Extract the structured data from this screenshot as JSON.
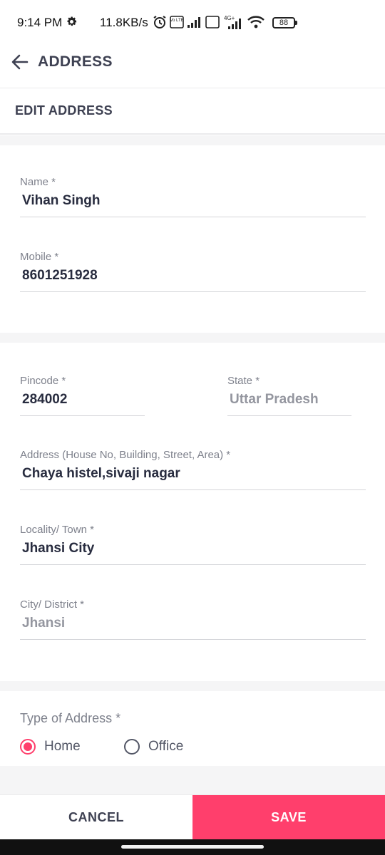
{
  "status_bar": {
    "time": "9:14 PM",
    "net_speed": "11.8KB/s",
    "battery": "88",
    "network_label": "4G+",
    "volte_label": "Vo LTE",
    "icons": [
      "gear-icon",
      "alarm-icon",
      "signal-icon",
      "wifi-icon",
      "battery-icon"
    ]
  },
  "header": {
    "title": "ADDRESS",
    "back_icon": "arrow-left-icon"
  },
  "section": {
    "title": "EDIT ADDRESS"
  },
  "form": {
    "name": {
      "label": "Name *",
      "value": "Vihan Singh"
    },
    "mobile": {
      "label": "Mobile *",
      "value": "8601251928"
    },
    "pincode": {
      "label": "Pincode *",
      "value": "284002"
    },
    "state": {
      "label": "State *",
      "value": "Uttar Pradesh"
    },
    "address": {
      "label": "Address (House No, Building, Street, Area) *",
      "value": "Chaya histel,sivaji nagar"
    },
    "locality": {
      "label": "Locality/ Town *",
      "value": "Jhansi City"
    },
    "city": {
      "label": "City/ District *",
      "value": "Jhansi"
    }
  },
  "address_type": {
    "label": "Type of Address *",
    "options": [
      {
        "label": "Home",
        "selected": true
      },
      {
        "label": "Office",
        "selected": false
      }
    ]
  },
  "actions": {
    "cancel": "CANCEL",
    "save": "SAVE"
  },
  "colors": {
    "accent": "#ff3f6c",
    "text_dark": "#282c3f",
    "text_muted": "#7e818c",
    "divider": "#d4d5d9",
    "section_gap": "#f5f5f6"
  }
}
